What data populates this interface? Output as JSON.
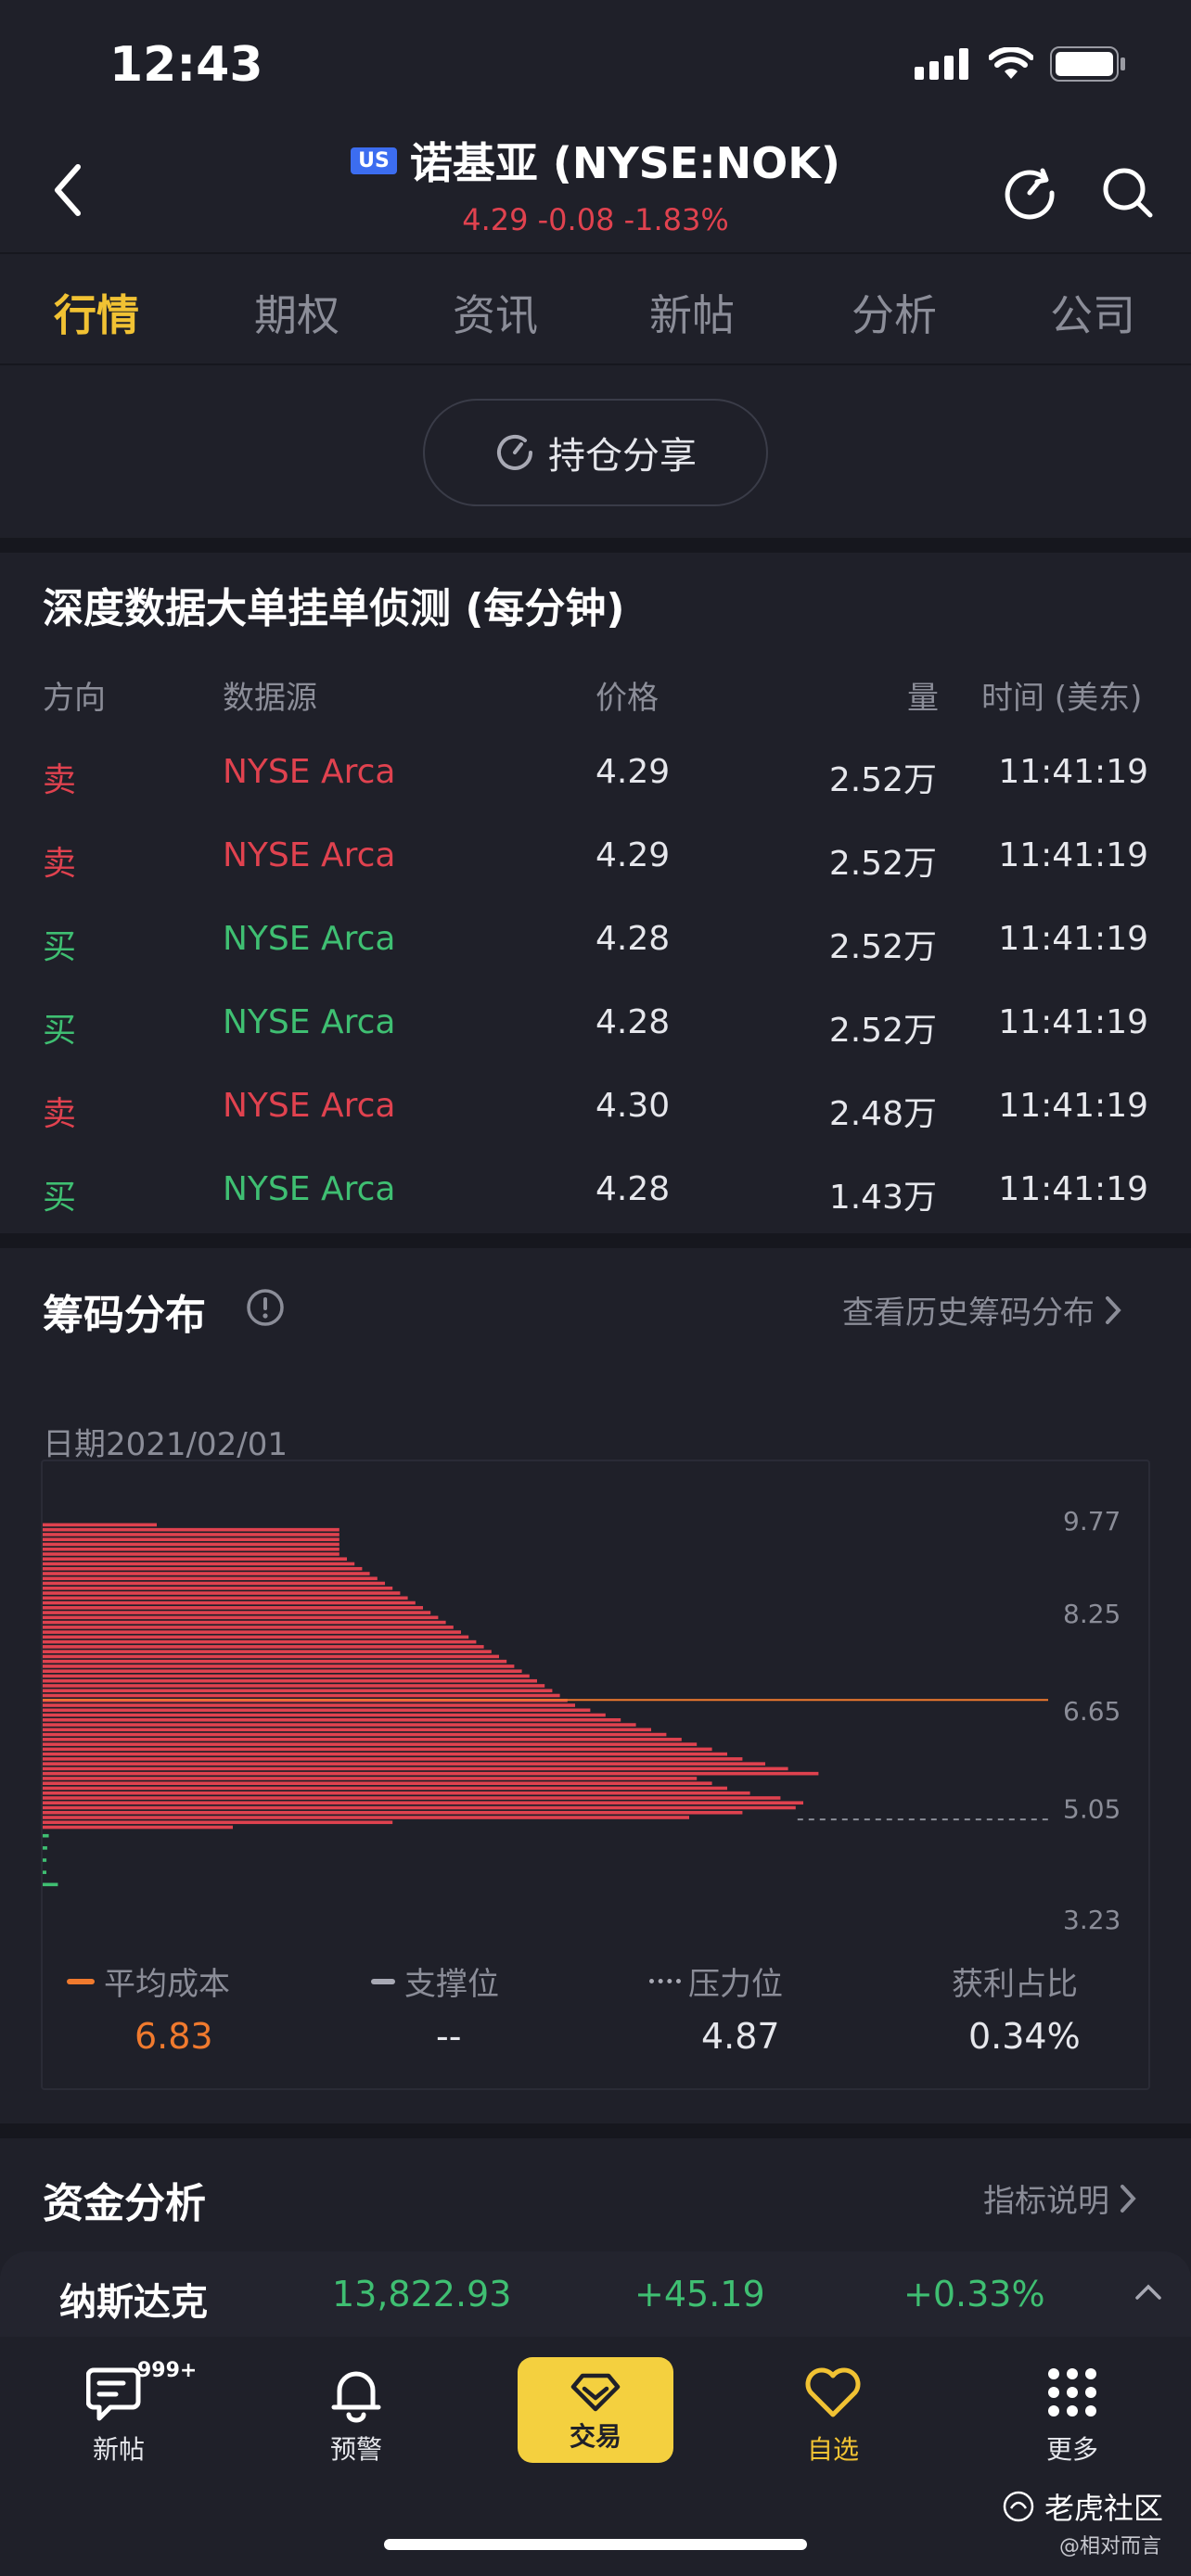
{
  "status": {
    "time": "12:43"
  },
  "header": {
    "badge": "US",
    "title": "诺基亚 (NYSE:NOK)",
    "quote": "4.29 -0.08 -1.83%"
  },
  "tabs": [
    {
      "label": "行情",
      "active": true
    },
    {
      "label": "期权"
    },
    {
      "label": "资讯"
    },
    {
      "label": "新帖"
    },
    {
      "label": "分析"
    },
    {
      "label": "公司"
    }
  ],
  "share": {
    "label": "持仓分享"
  },
  "depth": {
    "title": "深度数据大单挂单侦测 (每分钟)",
    "headers": {
      "side": "方向",
      "source": "数据源",
      "price": "价格",
      "qty": "量",
      "time": "时间 (美东)"
    },
    "rows": [
      {
        "side": "卖",
        "source": "NYSE Arca",
        "price": "4.29",
        "qty": "2.52万",
        "time": "11:41:19",
        "type": "sell"
      },
      {
        "side": "卖",
        "source": "NYSE Arca",
        "price": "4.29",
        "qty": "2.52万",
        "time": "11:41:19",
        "type": "sell"
      },
      {
        "side": "买",
        "source": "NYSE Arca",
        "price": "4.28",
        "qty": "2.52万",
        "time": "11:41:19",
        "type": "buy"
      },
      {
        "side": "买",
        "source": "NYSE Arca",
        "price": "4.28",
        "qty": "2.52万",
        "time": "11:41:19",
        "type": "buy"
      },
      {
        "side": "卖",
        "source": "NYSE Arca",
        "price": "4.30",
        "qty": "2.48万",
        "time": "11:41:19",
        "type": "sell"
      },
      {
        "side": "买",
        "source": "NYSE Arca",
        "price": "4.28",
        "qty": "1.43万",
        "time": "11:41:19",
        "type": "buy"
      }
    ]
  },
  "chips": {
    "title": "筹码分布",
    "history_link": "查看历史筹码分布",
    "date_label": "日期2021/02/01",
    "y_ticks": [
      "9.77",
      "8.25",
      "6.65",
      "5.05",
      "3.23"
    ],
    "legend": [
      {
        "label": "平均成本",
        "value": "6.83",
        "color": "#f07a2e"
      },
      {
        "label": "支撑位",
        "value": "--",
        "color": "#a8a9b4"
      },
      {
        "label": "压力位",
        "value": "4.87",
        "color": "#a8a9b4"
      },
      {
        "label": "获利占比",
        "value": "0.34%",
        "color": ""
      }
    ]
  },
  "chart_data": {
    "type": "bar",
    "orientation": "horizontal",
    "title": "",
    "ylim": [
      3.23,
      9.77
    ],
    "y_ticks": [
      9.77,
      8.25,
      6.65,
      5.05,
      3.23
    ],
    "avg_cost": 6.83,
    "resistance": 4.87,
    "loss_series": {
      "prices": [
        9.7,
        9.62,
        9.54,
        9.46,
        9.38,
        9.3,
        9.22,
        9.14,
        9.06,
        8.98,
        8.9,
        8.82,
        8.74,
        8.66,
        8.58,
        8.5,
        8.42,
        8.34,
        8.26,
        8.18,
        8.1,
        8.02,
        7.94,
        7.86,
        7.78,
        7.7,
        7.62,
        7.54,
        7.46,
        7.38,
        7.3,
        7.22,
        7.14,
        7.06,
        6.98,
        6.9,
        6.82,
        6.74,
        6.66,
        6.58,
        6.5,
        6.42,
        6.34,
        6.26,
        6.18,
        6.1,
        6.02,
        5.94,
        5.86,
        5.78,
        5.7,
        5.62,
        5.54,
        5.46,
        5.38,
        5.3,
        5.22,
        5.14,
        5.06,
        4.98,
        4.9,
        4.82,
        4.74
      ],
      "values": [
        0.15,
        0.39,
        0.39,
        0.39,
        0.39,
        0.39,
        0.39,
        0.4,
        0.41,
        0.42,
        0.43,
        0.44,
        0.45,
        0.46,
        0.47,
        0.48,
        0.49,
        0.5,
        0.51,
        0.52,
        0.53,
        0.54,
        0.55,
        0.56,
        0.57,
        0.58,
        0.59,
        0.6,
        0.61,
        0.62,
        0.63,
        0.64,
        0.65,
        0.66,
        0.67,
        0.68,
        0.69,
        0.7,
        0.72,
        0.74,
        0.76,
        0.78,
        0.8,
        0.82,
        0.84,
        0.86,
        0.88,
        0.9,
        0.92,
        0.95,
        0.98,
        1.02,
        0.86,
        0.88,
        0.9,
        0.93,
        0.97,
        1.0,
        0.99,
        0.92,
        0.85,
        0.46,
        0.25
      ]
    },
    "profit_series": {
      "prices": [
        4.6,
        4.4,
        4.2,
        4.0,
        3.8
      ],
      "values": [
        0.008,
        0.006,
        0.005,
        0.004,
        0.02
      ]
    }
  },
  "funds": {
    "title": "资金分析",
    "link": "指标说明"
  },
  "ticker": {
    "name": "纳斯达克",
    "value": "13,822.93",
    "change": "+45.19",
    "pct": "+0.33%"
  },
  "nav": [
    {
      "label": "新帖",
      "badge": "999+"
    },
    {
      "label": "预警"
    },
    {
      "label": "交易"
    },
    {
      "label": "自选"
    },
    {
      "label": "更多"
    }
  ],
  "watermark": {
    "brand": "老虎社区",
    "user": "@相对而言"
  }
}
